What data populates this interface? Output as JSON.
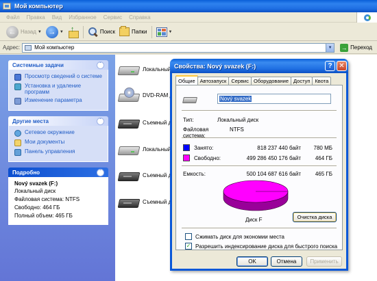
{
  "window": {
    "title": "Мой компьютер"
  },
  "menu": [
    "Файл",
    "Правка",
    "Вид",
    "Избранное",
    "Сервис",
    "Справка"
  ],
  "toolbar": {
    "back_label": "Назад",
    "search_label": "Поиск",
    "folders_label": "Папки"
  },
  "address": {
    "label": "Адрес:",
    "value": "Мой компьютер",
    "go_label": "Переход"
  },
  "sidebar": {
    "system_tasks": {
      "title": "Системные задачи",
      "items": [
        "Просмотр сведений о системе",
        "Установка и удаление программ",
        "Изменение параметра"
      ]
    },
    "other_places": {
      "title": "Другие места",
      "items": [
        "Сетевое окружение",
        "Мои документы",
        "Панель управления"
      ]
    },
    "details": {
      "title": "Подробно",
      "name": "Nový svazek (F:)",
      "type": "Локальный диск",
      "fs": "Файловая система: NTFS",
      "free": "Свободно: 464 ГБ",
      "total": "Полный объем: 465 ГБ"
    }
  },
  "drives": [
    {
      "label": "Локальный",
      "kind": "hdd"
    },
    {
      "label": "DVD-RAM д",
      "kind": "dvd"
    },
    {
      "label": "Съемный д",
      "kind": "rem"
    },
    {
      "label": "Локальный",
      "kind": "hdd"
    },
    {
      "label": "Съемный д",
      "kind": "rem"
    },
    {
      "label": "Съемный д",
      "kind": "rem"
    }
  ],
  "dialog": {
    "title": "Свойства: Nový svazek (F:)",
    "tabs": [
      "Общие",
      "Автозапуск",
      "Сервис",
      "Оборудование",
      "Доступ",
      "Квота"
    ],
    "volume_name": "Nový svazek",
    "type_key": "Тип:",
    "type_val": "Локальный диск",
    "fs_key": "Файловая система:",
    "fs_val": "NTFS",
    "used_label": "Занято:",
    "used_bytes": "818 237 440 байт",
    "used_human": "780 МБ",
    "free_label": "Свободно:",
    "free_bytes": "499 286 450 176 байт",
    "free_human": "464 ГБ",
    "cap_label": "Емкость:",
    "cap_bytes": "500 104 687 616 байт",
    "cap_human": "465 ГБ",
    "disk_label": "Диск F",
    "cleanup_label": "Очистка диска",
    "compress_label": "Сжимать диск для экономии места",
    "compress_checked": false,
    "index_label": "Разрешить индексирование диска для быстрого поиска",
    "index_checked": true,
    "ok_label": "OK",
    "cancel_label": "Отмена",
    "apply_label": "Применить",
    "colors": {
      "used": "#0000ff",
      "free": "#ff00ff"
    }
  }
}
